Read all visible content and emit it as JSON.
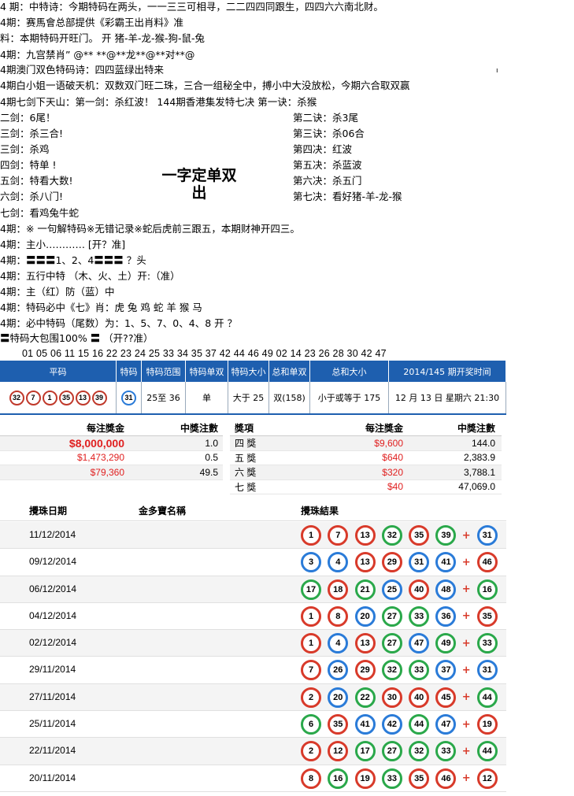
{
  "text_lines": [
    "4 期：中特诗：今期特码在两头，一一三三可相寻，二二四四同跟生，四四六六南北财。",
    "4期：赛馬會总部提供《彩霸王出肖料》准",
    "料：本期特码开旺门。          开 猪-羊-龙-猴-狗-鼠-兔",
    "4期：九宫禁肖”  @** **@**龙**@**对**@",
    "4期澳门双色特码诗：四四蓝绿出特来",
    "4期白小姐一语破天机：双数双门旺二珠，三合一组秘全中，搏小中大没放松，今期六合取双赢",
    "4期七剑下天山：第一剑：杀红波！        144期香港集发特七决  第一诀：杀猴",
    "二剑：6尾！",
    "三剑：杀三合!",
    "三剑：杀鸡",
    "四剑：特单 !",
    "五剑：特看大数!",
    "六剑：杀八门!",
    "七剑：看鸡兔牛蛇",
    "4期：※  一句解特码※无错记录※蛇后虎前三跟五，本期财神开四三。",
    "4期：主小………… [开？准]",
    "4期：〓〓〓1、2、4〓〓〓 ？头",
    "4期：五行中特   （木、火、土）开:（准）",
    "4期：主（红）防（蓝）中",
    "4期：特码必中《七》肖：虎 兔 鸡 蛇 羊 猴 马",
    "4期：必中特码（尾数）为：1、5、7、0、4、8       开 ？",
    "〓特码大包围100% 〓   （开??准）"
  ],
  "right_col": [
    "第二诀：杀3尾",
    "第三诀：杀06合",
    "第四决：红波",
    "第五决：杀蓝波",
    "第六决：杀五门",
    "第七决：看好猪-羊-龙-猴"
  ],
  "big_text": {
    "line1": "一字定单双",
    "line2": "出"
  },
  "marker": "ı",
  "numbers_row": "01  05  06  11  15  16  22  23  24  25  33  34  35  37  42  44  46  49 02  14  23  26  28  30  42  47",
  "draw": {
    "headers": [
      "平码",
      "特码",
      "特码范围",
      "特码单双",
      "特码大小",
      "总和单双",
      "总和大小",
      "2014/145 期开奖时间"
    ],
    "balls": [
      "32",
      "7",
      "1",
      "35",
      "13",
      "39"
    ],
    "special": "31",
    "range": "25至 36",
    "odd_even": "单",
    "size": "大于 25",
    "sum_odd_even": "双(158)",
    "sum_size": "小于或等于 175",
    "date": "12 月 13 日  星期六  21:30"
  },
  "prizes_left": {
    "headers": [
      "每注獎金",
      "中獎注數"
    ],
    "rows": [
      {
        "amount": "$8,000,000",
        "count": "1.0"
      },
      {
        "amount": "$1,473,290",
        "count": "0.5"
      },
      {
        "amount": "$79,360",
        "count": "49.5"
      }
    ]
  },
  "prizes_right": {
    "headers": [
      "獎項",
      "每注獎金",
      "中獎注數"
    ],
    "rows": [
      {
        "name": "四 獎",
        "amount": "$9,600",
        "count": "144.0"
      },
      {
        "name": "五 獎",
        "amount": "$640",
        "count": "2,383.9"
      },
      {
        "name": "六 獎",
        "amount": "$320",
        "count": "3,788.1"
      },
      {
        "name": "七 獎",
        "amount": "$40",
        "count": "47,069.0"
      }
    ]
  },
  "history": {
    "headers": [
      "攪珠日期",
      "金多寶名稱",
      "攪珠結果"
    ],
    "plus": "+",
    "rows": [
      {
        "date": "11/12/2014",
        "balls": [
          [
            "1",
            "red"
          ],
          [
            "7",
            "red"
          ],
          [
            "13",
            "red"
          ],
          [
            "32",
            "green"
          ],
          [
            "35",
            "red"
          ],
          [
            "39",
            "green"
          ]
        ],
        "special": [
          "31",
          "blue"
        ]
      },
      {
        "date": "09/12/2014",
        "balls": [
          [
            "3",
            "blue"
          ],
          [
            "4",
            "blue"
          ],
          [
            "13",
            "red"
          ],
          [
            "29",
            "red"
          ],
          [
            "31",
            "blue"
          ],
          [
            "41",
            "blue"
          ]
        ],
        "special": [
          "46",
          "red"
        ]
      },
      {
        "date": "06/12/2014",
        "balls": [
          [
            "17",
            "green"
          ],
          [
            "18",
            "red"
          ],
          [
            "21",
            "green"
          ],
          [
            "25",
            "blue"
          ],
          [
            "40",
            "red"
          ],
          [
            "48",
            "blue"
          ]
        ],
        "special": [
          "16",
          "green"
        ]
      },
      {
        "date": "04/12/2014",
        "balls": [
          [
            "1",
            "red"
          ],
          [
            "8",
            "red"
          ],
          [
            "20",
            "blue"
          ],
          [
            "27",
            "green"
          ],
          [
            "33",
            "green"
          ],
          [
            "36",
            "blue"
          ]
        ],
        "special": [
          "35",
          "red"
        ]
      },
      {
        "date": "02/12/2014",
        "balls": [
          [
            "1",
            "red"
          ],
          [
            "4",
            "blue"
          ],
          [
            "13",
            "red"
          ],
          [
            "27",
            "green"
          ],
          [
            "47",
            "blue"
          ],
          [
            "49",
            "green"
          ]
        ],
        "special": [
          "33",
          "green"
        ]
      },
      {
        "date": "29/11/2014",
        "balls": [
          [
            "7",
            "red"
          ],
          [
            "26",
            "blue"
          ],
          [
            "29",
            "red"
          ],
          [
            "32",
            "green"
          ],
          [
            "33",
            "green"
          ],
          [
            "37",
            "blue"
          ]
        ],
        "special": [
          "31",
          "blue"
        ]
      },
      {
        "date": "27/11/2014",
        "balls": [
          [
            "2",
            "red"
          ],
          [
            "20",
            "blue"
          ],
          [
            "22",
            "green"
          ],
          [
            "30",
            "red"
          ],
          [
            "40",
            "red"
          ],
          [
            "45",
            "red"
          ]
        ],
        "special": [
          "44",
          "green"
        ]
      },
      {
        "date": "25/11/2014",
        "balls": [
          [
            "6",
            "green"
          ],
          [
            "35",
            "red"
          ],
          [
            "41",
            "blue"
          ],
          [
            "42",
            "blue"
          ],
          [
            "44",
            "green"
          ],
          [
            "47",
            "blue"
          ]
        ],
        "special": [
          "19",
          "red"
        ]
      },
      {
        "date": "22/11/2014",
        "balls": [
          [
            "2",
            "red"
          ],
          [
            "12",
            "red"
          ],
          [
            "17",
            "green"
          ],
          [
            "27",
            "green"
          ],
          [
            "32",
            "green"
          ],
          [
            "33",
            "green"
          ]
        ],
        "special": [
          "44",
          "green"
        ]
      },
      {
        "date": "20/11/2014",
        "balls": [
          [
            "8",
            "red"
          ],
          [
            "16",
            "green"
          ],
          [
            "19",
            "red"
          ],
          [
            "33",
            "green"
          ],
          [
            "35",
            "red"
          ],
          [
            "46",
            "red"
          ]
        ],
        "special": [
          "12",
          "red"
        ]
      }
    ]
  },
  "colors": {
    "header_blue": "#1e5faf",
    "ball_red": "#d83a2a",
    "ball_blue": "#2a7bd8",
    "ball_green": "#2aa84a",
    "prize_red": "#e02020"
  }
}
